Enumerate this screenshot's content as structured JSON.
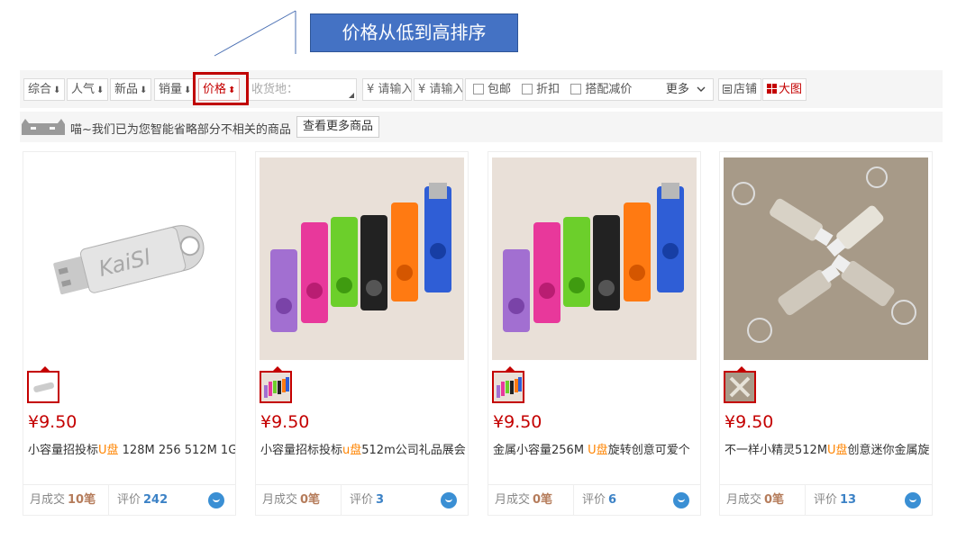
{
  "annotation": {
    "label": "价格从低到高排序"
  },
  "toolbar": {
    "sort_options": [
      {
        "label": "综合",
        "arrow": "⬇"
      },
      {
        "label": "人气",
        "arrow": "⬇"
      },
      {
        "label": "新品",
        "arrow": "⬇"
      },
      {
        "label": "销量",
        "arrow": "⬇"
      },
      {
        "label": "价格",
        "arrow": "⬍"
      }
    ],
    "ship_to_placeholder": "收货地：",
    "price_min_placeholder": "¥ 请输入",
    "price_max_placeholder": "¥ 请输入",
    "filters": [
      "包邮",
      "折扣",
      "搭配减价"
    ],
    "more_label": "更多",
    "more_icon": "chevron-down-icon",
    "view_shop_label": "店铺",
    "view_grid_label": "大图"
  },
  "notice": {
    "text": "喵~我们已为您智能省略部分不相关的商品",
    "button_label": "查看更多商品"
  },
  "products": [
    {
      "price": "¥9.50",
      "title_pre": "小容量招投标",
      "title_hl": "U盘",
      "title_post": " 128M 256 512M 1G",
      "sales_label": "月成交",
      "sales_value": "10笔",
      "review_label": "评价",
      "review_value": "242"
    },
    {
      "price": "¥9.50",
      "title_pre": "小容量招标投标",
      "title_hl": "u盘",
      "title_post": "512m公司礼品展会",
      "sales_label": "月成交",
      "sales_value": "0笔",
      "review_label": "评价",
      "review_value": "3"
    },
    {
      "price": "¥9.50",
      "title_pre": "金属小容量256M ",
      "title_hl": "U盘",
      "title_post": "旋转创意可爱个",
      "sales_label": "月成交",
      "sales_value": "0笔",
      "review_label": "评价",
      "review_value": "6"
    },
    {
      "price": "¥9.50",
      "title_pre": "不一样小精灵512M",
      "title_hl": "U盘",
      "title_post": "创意迷你金属旋",
      "sales_label": "月成交",
      "sales_value": "0笔",
      "review_label": "评价",
      "review_value": "13"
    }
  ],
  "colors": {
    "accent": "#c40000",
    "highlight": "#ff8400",
    "callout": "#4472c4"
  }
}
